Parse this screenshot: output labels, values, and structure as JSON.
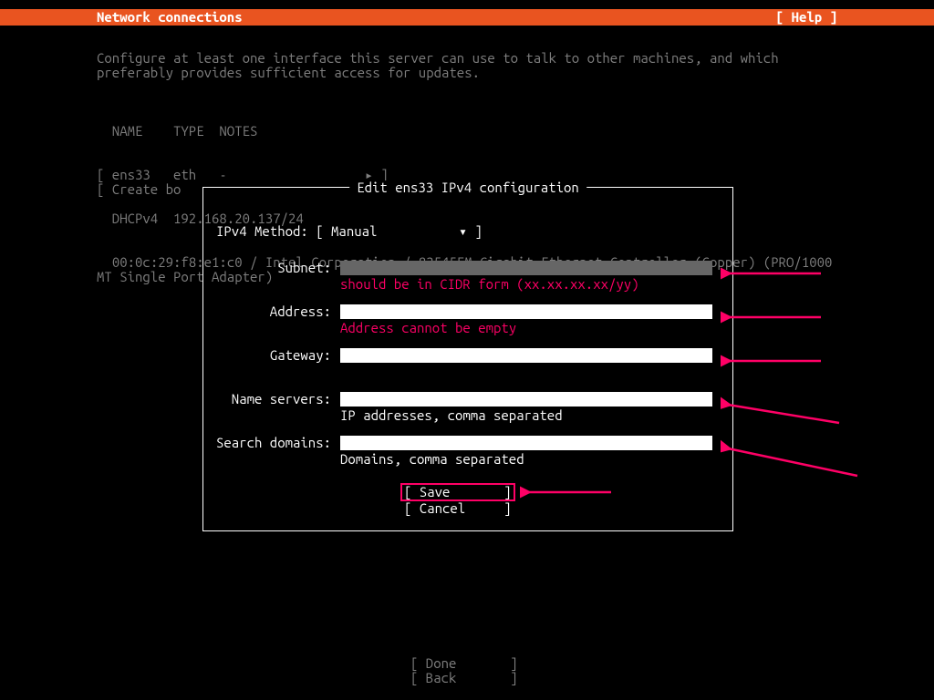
{
  "header": {
    "title": "Network connections",
    "help": "[ Help ]"
  },
  "intro": "Configure at least one interface this server can use to talk to other machines, and which preferably provides sufficient access for updates.",
  "iface": {
    "headers": "  NAME    TYPE  NOTES",
    "row": "[ ens33   eth   -                  ▸ ]",
    "dhcp": "  DHCPv4  192.168.20.137/24",
    "hw": "  00:0c:29:f8:e1:c0 / Intel Corporation / 82545EM Gigabit Ethernet Controller (Copper) (PRO/1000 MT Single Port Adapter)"
  },
  "create_bond": "[ Create bo",
  "dialog": {
    "title": "Edit ens33 IPv4 configuration",
    "method_label": "IPv4 Method:   ",
    "method_open": "[ ",
    "method_value": "Manual",
    "method_caret": "▾",
    "method_close": " ]",
    "fields": {
      "subnet": {
        "label": "Subnet:",
        "hint": "should be in CIDR form (xx.xx.xx.xx/yy)",
        "error": true,
        "filled": false
      },
      "address": {
        "label": "Address:",
        "hint": "Address cannot be empty",
        "error": true,
        "filled": true
      },
      "gateway": {
        "label": "Gateway:",
        "hint": "",
        "error": false,
        "filled": true
      },
      "ns": {
        "label": "Name servers:",
        "hint": "IP addresses, comma separated",
        "error": false,
        "filled": true
      },
      "search": {
        "label": "Search domains:",
        "hint": "Domains, comma separated",
        "error": false,
        "filled": true
      }
    },
    "save": "[ Save       ]",
    "cancel": "[ Cancel     ]"
  },
  "footer": {
    "done": "[ Done       ]",
    "back": "[ Back       ]"
  }
}
